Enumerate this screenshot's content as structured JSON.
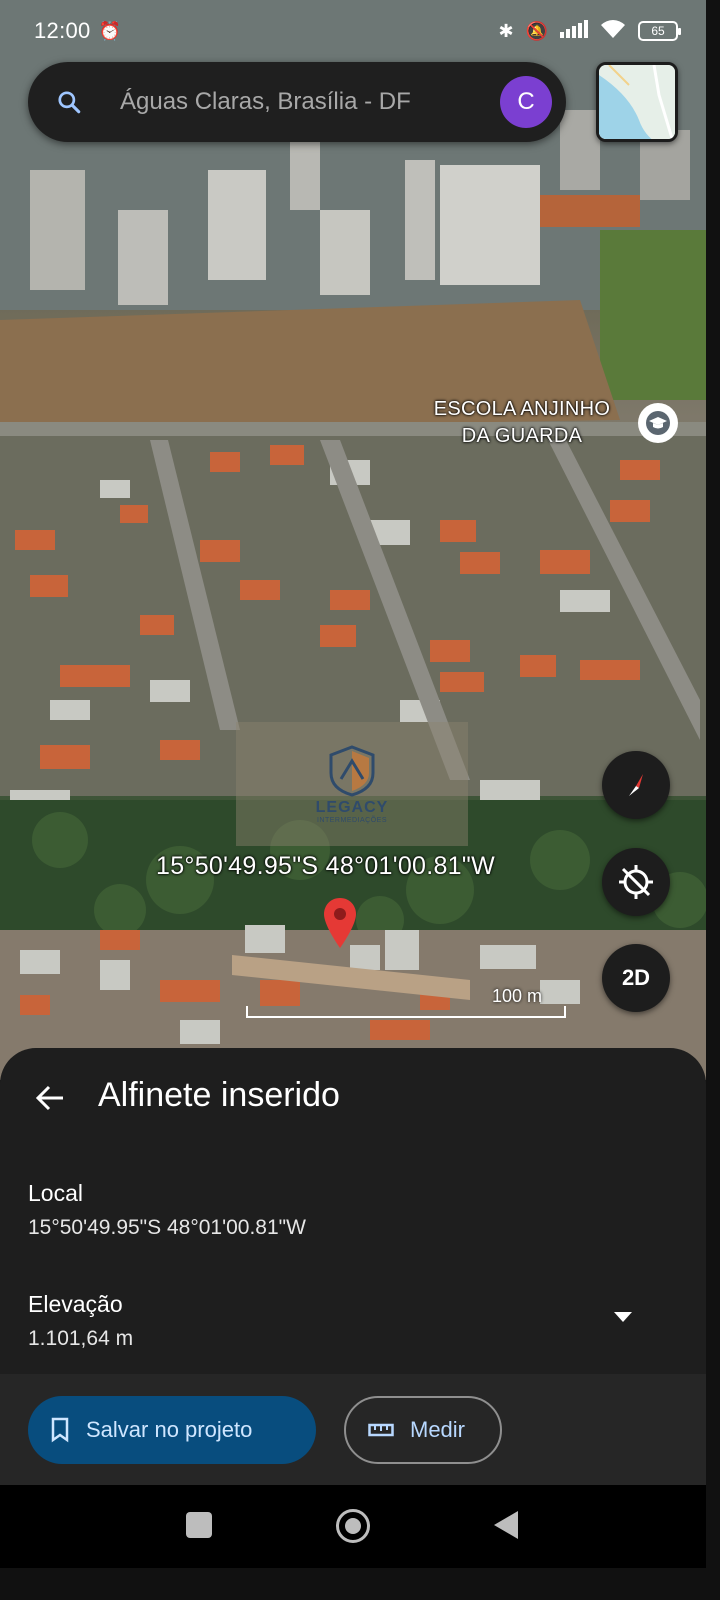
{
  "status_bar": {
    "time": "12:00",
    "battery": "65"
  },
  "search": {
    "placeholder": "Águas Claras, Brasília - DF",
    "avatar_letter": "C"
  },
  "map": {
    "poi_label_line1": "ESCOLA ANJINHO",
    "poi_label_line2": "DA GUARDA",
    "pin_coordinates": "15°50'49.95\"S 48°01'00.81\"W",
    "scale_label": "100 m",
    "view_mode_button": "2D",
    "watermark": {
      "name": "LEGACY",
      "subtitle": "INTERMEDIAÇÕES"
    }
  },
  "sheet": {
    "title": "Alfinete inserido",
    "local_label": "Local",
    "local_value": "15°50'49.95\"S 48°01'00.81\"W",
    "elevation_label": "Elevação",
    "elevation_value": "1.101,64 m",
    "save_button": "Salvar no projeto",
    "measure_button": "Medir"
  },
  "colors": {
    "accent_button": "#084d7e",
    "avatar": "#7b3fd1",
    "pin": "#e53935"
  }
}
